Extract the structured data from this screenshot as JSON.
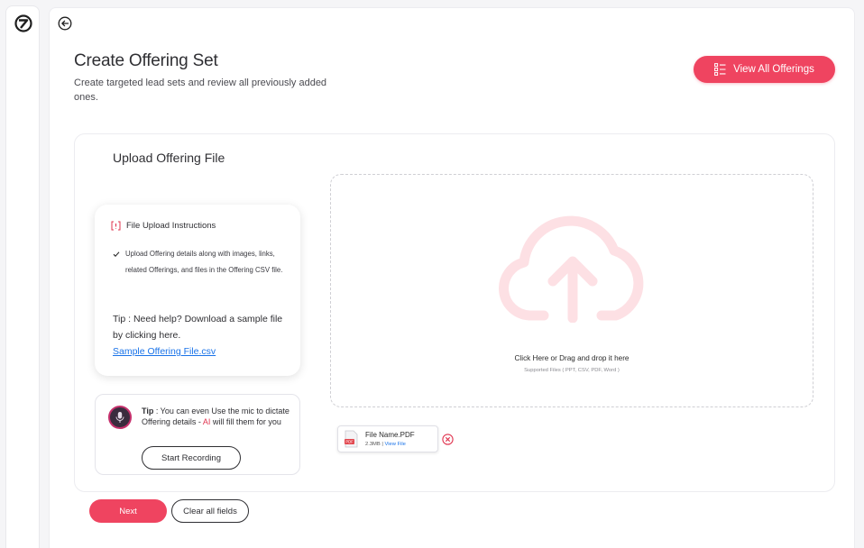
{
  "header": {
    "title": "Create Offering Set",
    "subtitle": "Create targeted lead sets and review all previously added ones.",
    "view_all_label": "View All Offerings"
  },
  "upload": {
    "card_title": "Upload Offering File",
    "instructions": {
      "heading": "File Upload Instructions",
      "items": [
        "Upload Offering details along with images, links, related Offerings, and files in the Offering CSV file."
      ],
      "tip_prefix": "Tip : ",
      "tip_text": "Need help? Download a sample file by clicking here.",
      "sample_link": "Sample Offering File.csv"
    },
    "mic_tip": {
      "prefix": "Tip",
      "text_before": " : You can even Use the mic to dictate Offering details - ",
      "ai": "AI",
      "text_after": " will fill them for you",
      "record_label": "Start Recording"
    },
    "dropzone": {
      "main_text": "Click Here or Drag and drop it here",
      "supported_text": "Supported Files ( PPT, CSV, PDF, Word )"
    },
    "file": {
      "type_badge": "PDF",
      "name": "File Name.PDF",
      "size": "2.3MB",
      "separator": " | ",
      "view_label": "View File"
    }
  },
  "footer": {
    "next_label": "Next",
    "clear_label": "Clear all fields"
  },
  "colors": {
    "accent": "#ef4460",
    "link": "#1a73e8",
    "ai_highlight": "#e0344f",
    "cloud": "#fde0e4"
  },
  "icons": {
    "logo": "brand-logo-icon",
    "back": "back-arrow-icon",
    "view_all": "list-icon",
    "instructions": "instructions-icon",
    "check": "check-icon",
    "mic": "mic-icon",
    "upload": "cloud-upload-icon",
    "file": "pdf-file-icon",
    "remove": "remove-circle-icon"
  }
}
